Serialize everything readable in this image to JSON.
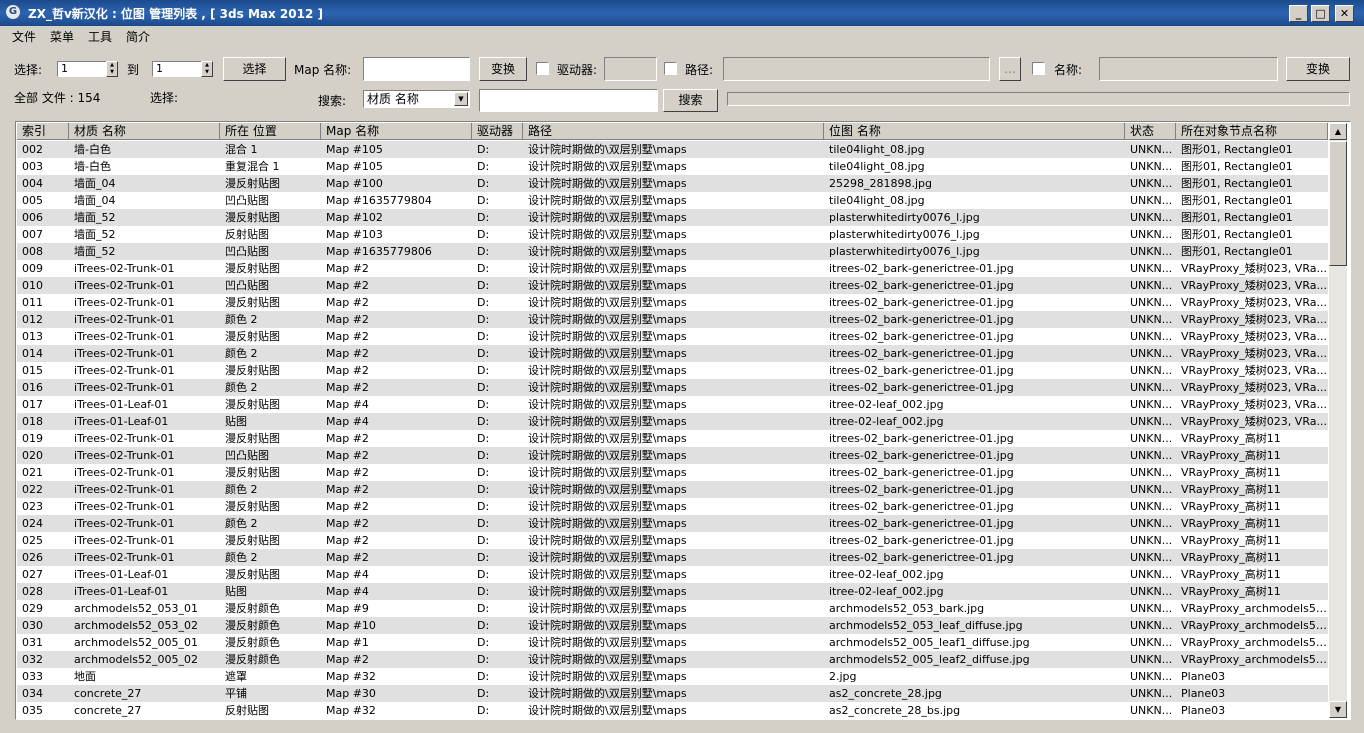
{
  "window": {
    "title": "ZX_哲v新汉化 : 位图 管理列表 , [ 3ds Max 2012 ]",
    "app_icon": "3ds-max-icon",
    "minimize": "_",
    "maximize": "□",
    "close": "✕"
  },
  "menu": [
    "文件",
    "菜单",
    "工具",
    "简介"
  ],
  "toolbar": {
    "select_label": "选择:",
    "from_value": "1",
    "to_label": "到",
    "to_value": "1",
    "select_button": "选择",
    "map_name_label": "Map 名称:",
    "map_name_value": "",
    "convert_button": "变换",
    "drive_label": "驱动器:",
    "path_label": "路径:",
    "browse_button": "...",
    "name_label": "名称:",
    "convert_button2": "变换",
    "total_files_label": "全部 文件 : 154",
    "selected_label": "选择:",
    "search_label": "搜索:",
    "search_field_option": "材质 名称",
    "search_value": "",
    "search_button": "搜索"
  },
  "table": {
    "columns": [
      "索引",
      "材质 名称",
      "所在 位置",
      "Map 名称",
      "驱动器",
      "路径",
      "位图 名称",
      "状态",
      "所在对象节点名称"
    ],
    "rows": [
      [
        "002",
        "墙-白色",
        "混合 1",
        "Map #105",
        "D:",
        "设计院时期做的\\双层别墅\\maps",
        "tile04light_08.jpg",
        "UNKN...",
        "图形01, Rectangle01"
      ],
      [
        "003",
        "墙-白色",
        "重复混合 1",
        "Map #105",
        "D:",
        "设计院时期做的\\双层别墅\\maps",
        "tile04light_08.jpg",
        "UNKN...",
        "图形01, Rectangle01"
      ],
      [
        "004",
        "墙面_04",
        "漫反射贴图",
        "Map #100",
        "D:",
        "设计院时期做的\\双层别墅\\maps",
        "25298_281898.jpg",
        "UNKN...",
        "图形01, Rectangle01"
      ],
      [
        "005",
        "墙面_04",
        "凹凸贴图",
        "Map #1635779804",
        "D:",
        "设计院时期做的\\双层别墅\\maps",
        "tile04light_08.jpg",
        "UNKN...",
        "图形01, Rectangle01"
      ],
      [
        "006",
        "墙面_52",
        "漫反射贴图",
        "Map #102",
        "D:",
        "设计院时期做的\\双层别墅\\maps",
        "plasterwhitedirty0076_l.jpg",
        "UNKN...",
        "图形01, Rectangle01"
      ],
      [
        "007",
        "墙面_52",
        "反射贴图",
        "Map #103",
        "D:",
        "设计院时期做的\\双层别墅\\maps",
        "plasterwhitedirty0076_l.jpg",
        "UNKN...",
        "图形01, Rectangle01"
      ],
      [
        "008",
        "墙面_52",
        "凹凸贴图",
        "Map #1635779806",
        "D:",
        "设计院时期做的\\双层别墅\\maps",
        "plasterwhitedirty0076_l.jpg",
        "UNKN...",
        "图形01, Rectangle01"
      ],
      [
        "009",
        "iTrees-02-Trunk-01",
        "漫反射贴图",
        "Map #2",
        "D:",
        "设计院时期做的\\双层别墅\\maps",
        "itrees-02_bark-generictree-01.jpg",
        "UNKN...",
        "VRayProxy_矮树023, VRa..."
      ],
      [
        "010",
        "iTrees-02-Trunk-01",
        "凹凸贴图",
        "Map #2",
        "D:",
        "设计院时期做的\\双层别墅\\maps",
        "itrees-02_bark-generictree-01.jpg",
        "UNKN...",
        "VRayProxy_矮树023, VRa..."
      ],
      [
        "011",
        "iTrees-02-Trunk-01",
        "漫反射贴图",
        "Map #2",
        "D:",
        "设计院时期做的\\双层别墅\\maps",
        "itrees-02_bark-generictree-01.jpg",
        "UNKN...",
        "VRayProxy_矮树023, VRa..."
      ],
      [
        "012",
        "iTrees-02-Trunk-01",
        "颜色 2",
        "Map #2",
        "D:",
        "设计院时期做的\\双层别墅\\maps",
        "itrees-02_bark-generictree-01.jpg",
        "UNKN...",
        "VRayProxy_矮树023, VRa..."
      ],
      [
        "013",
        "iTrees-02-Trunk-01",
        "漫反射贴图",
        "Map #2",
        "D:",
        "设计院时期做的\\双层别墅\\maps",
        "itrees-02_bark-generictree-01.jpg",
        "UNKN...",
        "VRayProxy_矮树023, VRa..."
      ],
      [
        "014",
        "iTrees-02-Trunk-01",
        "颜色 2",
        "Map #2",
        "D:",
        "设计院时期做的\\双层别墅\\maps",
        "itrees-02_bark-generictree-01.jpg",
        "UNKN...",
        "VRayProxy_矮树023, VRa..."
      ],
      [
        "015",
        "iTrees-02-Trunk-01",
        "漫反射贴图",
        "Map #2",
        "D:",
        "设计院时期做的\\双层别墅\\maps",
        "itrees-02_bark-generictree-01.jpg",
        "UNKN...",
        "VRayProxy_矮树023, VRa..."
      ],
      [
        "016",
        "iTrees-02-Trunk-01",
        "颜色 2",
        "Map #2",
        "D:",
        "设计院时期做的\\双层别墅\\maps",
        "itrees-02_bark-generictree-01.jpg",
        "UNKN...",
        "VRayProxy_矮树023, VRa..."
      ],
      [
        "017",
        "iTrees-01-Leaf-01",
        "漫反射贴图",
        "Map #4",
        "D:",
        "设计院时期做的\\双层别墅\\maps",
        "itree-02-leaf_002.jpg",
        "UNKN...",
        "VRayProxy_矮树023, VRa..."
      ],
      [
        "018",
        "iTrees-01-Leaf-01",
        "贴图",
        "Map #4",
        "D:",
        "设计院时期做的\\双层别墅\\maps",
        "itree-02-leaf_002.jpg",
        "UNKN...",
        "VRayProxy_矮树023, VRa..."
      ],
      [
        "019",
        "iTrees-02-Trunk-01",
        "漫反射贴图",
        "Map #2",
        "D:",
        "设计院时期做的\\双层别墅\\maps",
        "itrees-02_bark-generictree-01.jpg",
        "UNKN...",
        "VRayProxy_高树11"
      ],
      [
        "020",
        "iTrees-02-Trunk-01",
        "凹凸贴图",
        "Map #2",
        "D:",
        "设计院时期做的\\双层别墅\\maps",
        "itrees-02_bark-generictree-01.jpg",
        "UNKN...",
        "VRayProxy_高树11"
      ],
      [
        "021",
        "iTrees-02-Trunk-01",
        "漫反射贴图",
        "Map #2",
        "D:",
        "设计院时期做的\\双层别墅\\maps",
        "itrees-02_bark-generictree-01.jpg",
        "UNKN...",
        "VRayProxy_高树11"
      ],
      [
        "022",
        "iTrees-02-Trunk-01",
        "颜色 2",
        "Map #2",
        "D:",
        "设计院时期做的\\双层别墅\\maps",
        "itrees-02_bark-generictree-01.jpg",
        "UNKN...",
        "VRayProxy_高树11"
      ],
      [
        "023",
        "iTrees-02-Trunk-01",
        "漫反射贴图",
        "Map #2",
        "D:",
        "设计院时期做的\\双层别墅\\maps",
        "itrees-02_bark-generictree-01.jpg",
        "UNKN...",
        "VRayProxy_高树11"
      ],
      [
        "024",
        "iTrees-02-Trunk-01",
        "颜色 2",
        "Map #2",
        "D:",
        "设计院时期做的\\双层别墅\\maps",
        "itrees-02_bark-generictree-01.jpg",
        "UNKN...",
        "VRayProxy_高树11"
      ],
      [
        "025",
        "iTrees-02-Trunk-01",
        "漫反射贴图",
        "Map #2",
        "D:",
        "设计院时期做的\\双层别墅\\maps",
        "itrees-02_bark-generictree-01.jpg",
        "UNKN...",
        "VRayProxy_高树11"
      ],
      [
        "026",
        "iTrees-02-Trunk-01",
        "颜色 2",
        "Map #2",
        "D:",
        "设计院时期做的\\双层别墅\\maps",
        "itrees-02_bark-generictree-01.jpg",
        "UNKN...",
        "VRayProxy_高树11"
      ],
      [
        "027",
        "iTrees-01-Leaf-01",
        "漫反射贴图",
        "Map #4",
        "D:",
        "设计院时期做的\\双层别墅\\maps",
        "itree-02-leaf_002.jpg",
        "UNKN...",
        "VRayProxy_高树11"
      ],
      [
        "028",
        "iTrees-01-Leaf-01",
        "贴图",
        "Map #4",
        "D:",
        "设计院时期做的\\双层别墅\\maps",
        "itree-02-leaf_002.jpg",
        "UNKN...",
        "VRayProxy_高树11"
      ],
      [
        "029",
        "archmodels52_053_01",
        "漫反射颜色",
        "Map #9",
        "D:",
        "设计院时期做的\\双层别墅\\maps",
        "archmodels52_053_bark.jpg",
        "UNKN...",
        "VRayProxy_archmodels52..."
      ],
      [
        "030",
        "archmodels52_053_02",
        "漫反射颜色",
        "Map #10",
        "D:",
        "设计院时期做的\\双层别墅\\maps",
        "archmodels52_053_leaf_diffuse.jpg",
        "UNKN...",
        "VRayProxy_archmodels52..."
      ],
      [
        "031",
        "archmodels52_005_01",
        "漫反射颜色",
        "Map #1",
        "D:",
        "设计院时期做的\\双层别墅\\maps",
        "archmodels52_005_leaf1_diffuse.jpg",
        "UNKN...",
        "VRayProxy_archmodels52..."
      ],
      [
        "032",
        "archmodels52_005_02",
        "漫反射颜色",
        "Map #2",
        "D:",
        "设计院时期做的\\双层别墅\\maps",
        "archmodels52_005_leaf2_diffuse.jpg",
        "UNKN...",
        "VRayProxy_archmodels52..."
      ],
      [
        "033",
        "地面",
        "遮罩",
        "Map #32",
        "D:",
        "设计院时期做的\\双层别墅\\maps",
        "2.jpg",
        "UNKN...",
        "Plane03"
      ],
      [
        "034",
        "concrete_27",
        "平铺",
        "Map #30",
        "D:",
        "设计院时期做的\\双层别墅\\maps",
        "as2_concrete_28.jpg",
        "UNKN...",
        "Plane03"
      ],
      [
        "035",
        "concrete_27",
        "反射贴图",
        "Map #32",
        "D:",
        "设计院时期做的\\双层别墅\\maps",
        "as2_concrete_28_bs.jpg",
        "UNKN...",
        "Plane03"
      ]
    ]
  }
}
